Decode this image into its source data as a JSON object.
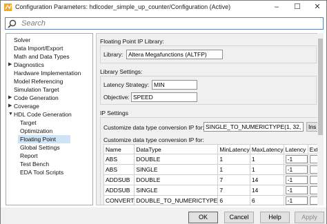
{
  "window": {
    "title": "Configuration Parameters: hdlcoder_simple_up_counter/Configuration (Active)"
  },
  "search": {
    "placeholder": "Search"
  },
  "tree": {
    "items": [
      {
        "label": "Solver"
      },
      {
        "label": "Data Import/Export"
      },
      {
        "label": "Math and Data Types"
      },
      {
        "label": "Diagnostics",
        "expandable": true
      },
      {
        "label": "Hardware Implementation"
      },
      {
        "label": "Model Referencing"
      },
      {
        "label": "Simulation Target"
      },
      {
        "label": "Code Generation",
        "expandable": true
      },
      {
        "label": "Coverage",
        "expandable": true
      },
      {
        "label": "HDL Code Generation",
        "expanded": true
      },
      {
        "label": "Target"
      },
      {
        "label": "Optimization"
      },
      {
        "label": "Floating Point",
        "selected": true
      },
      {
        "label": "Global Settings"
      },
      {
        "label": "Report"
      },
      {
        "label": "Test Bench"
      },
      {
        "label": "EDA Tool Scripts"
      }
    ]
  },
  "main": {
    "fp_library_title": "Floating Point IP Library:",
    "library_label": "Library:",
    "library_value": "Altera Megafunctions (ALTFP)",
    "library_settings_title": "Library Settings:",
    "latency_strategy_label": "Latency Strategy:",
    "latency_strategy_value": "MIN",
    "objective_label": "Objective:",
    "objective_value": "SPEED",
    "ip_settings_title": "IP Settings",
    "customize_label": "Customize data type conversion IP for:",
    "customize_value": "SINGLE_TO_NUMERICTYPE(1, 32, 1",
    "insert_button": "Ins",
    "table_label": "Customize data type conversion IP for:",
    "table": {
      "headers": [
        "Name",
        "DataType",
        "MinLatency",
        "MaxLatency",
        "Latency",
        "Extra"
      ],
      "rows": [
        {
          "name": "ABS",
          "datatype": "DOUBLE",
          "min": "1",
          "max": "1",
          "latency": "-1"
        },
        {
          "name": "ABS",
          "datatype": "SINGLE",
          "min": "1",
          "max": "1",
          "latency": "-1"
        },
        {
          "name": "ADDSUB",
          "datatype": "DOUBLE",
          "min": "7",
          "max": "14",
          "latency": "-1"
        },
        {
          "name": "ADDSUB",
          "datatype": "SINGLE",
          "min": "7",
          "max": "14",
          "latency": "-1"
        },
        {
          "name": "CONVERT",
          "datatype": "DOUBLE_TO_NUMERICTYPE",
          "min": "6",
          "max": "6",
          "latency": "-1"
        }
      ]
    }
  },
  "buttons": {
    "ok": "OK",
    "cancel": "Cancel",
    "help": "Help",
    "apply": "Apply"
  }
}
